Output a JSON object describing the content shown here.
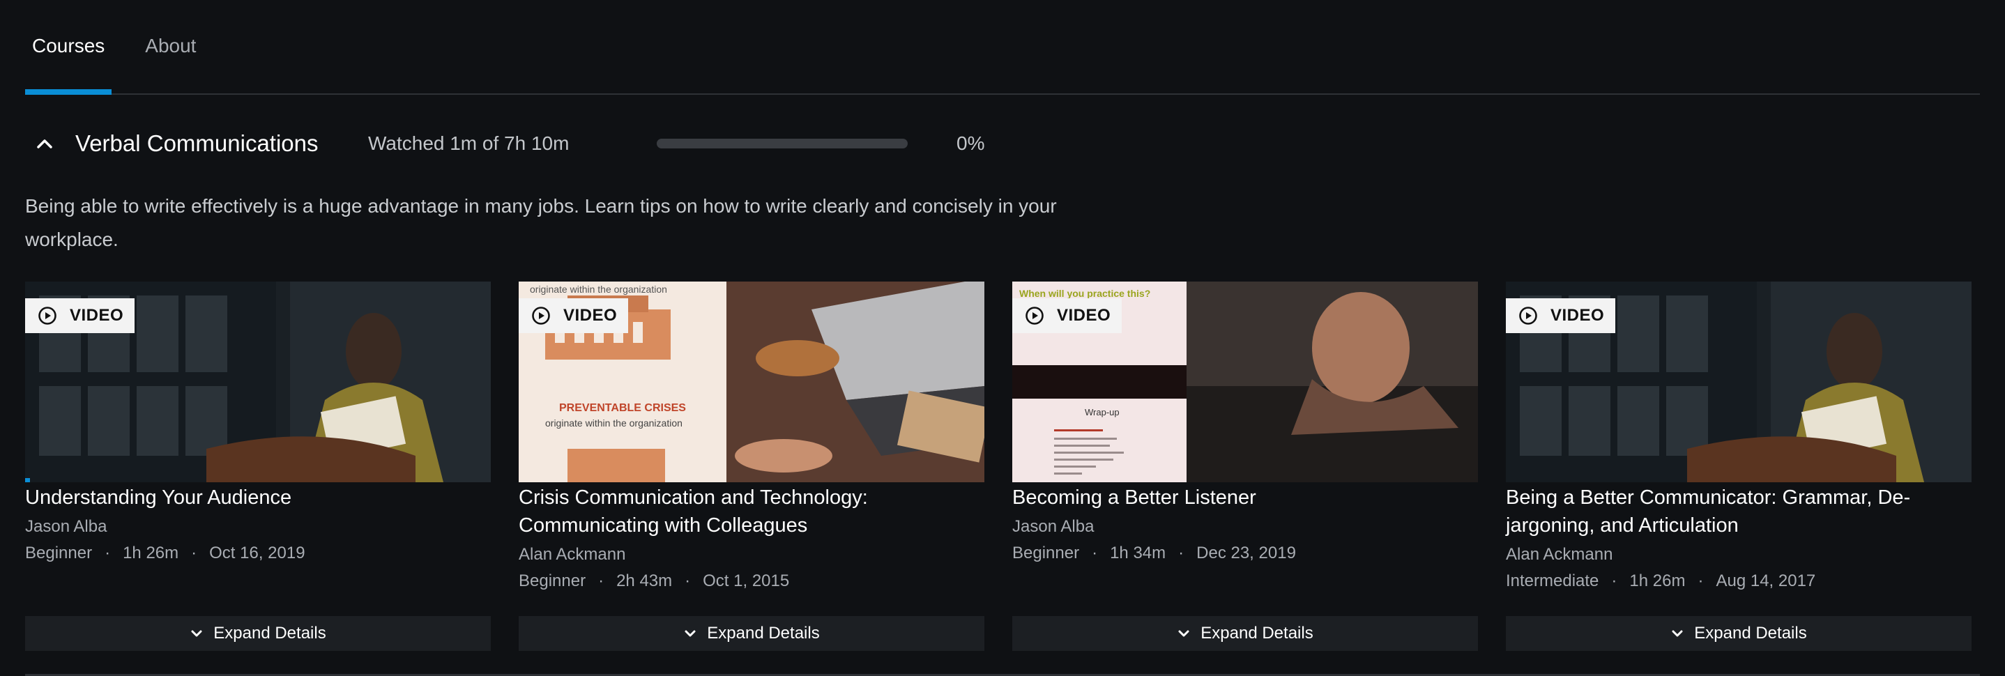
{
  "tabs": [
    {
      "label": "Courses",
      "active": true
    },
    {
      "label": "About",
      "active": false
    }
  ],
  "section": {
    "title": "Verbal Communications",
    "watched": "Watched 1m of 7h 10m",
    "progress_fraction": 0.0,
    "progress_text": "0%",
    "description": "Being able to write effectively is a huge advantage in many jobs. Learn tips on how to write clearly and concisely in your workplace."
  },
  "accent_color": "#0a8ed6",
  "cards": [
    {
      "badge": "VIDEO",
      "title": "Understanding Your Audience",
      "author": "Jason Alba",
      "level": "Beginner",
      "duration": "1h 26m",
      "date": "Oct 16, 2019",
      "expand": "Expand Details",
      "progress_fraction": 0.01
    },
    {
      "badge": "VIDEO",
      "title": "Crisis Communication and Technology: Communicating with Colleagues",
      "author": "Alan Ackmann",
      "level": "Beginner",
      "duration": "2h 43m",
      "date": "Oct 1, 2015",
      "expand": "Expand Details",
      "slide_top": "originate within the organization",
      "slide_heading": "PREVENTABLE CRISES",
      "slide_sub": "originate within the organization"
    },
    {
      "badge": "VIDEO",
      "title": "Becoming a Better Listener",
      "author": "Jason Alba",
      "level": "Beginner",
      "duration": "1h 34m",
      "date": "Dec 23, 2019",
      "expand": "Expand Details",
      "slide_top": "When will you practice this?",
      "slide_heading": "Wrap-up"
    },
    {
      "badge": "VIDEO",
      "title": "Being a Better Communicator: Grammar, De-jargoning, and Articulation",
      "author": "Alan Ackmann",
      "level": "Intermediate",
      "duration": "1h 26m",
      "date": "Aug 14, 2017",
      "expand": "Expand Details"
    }
  ]
}
